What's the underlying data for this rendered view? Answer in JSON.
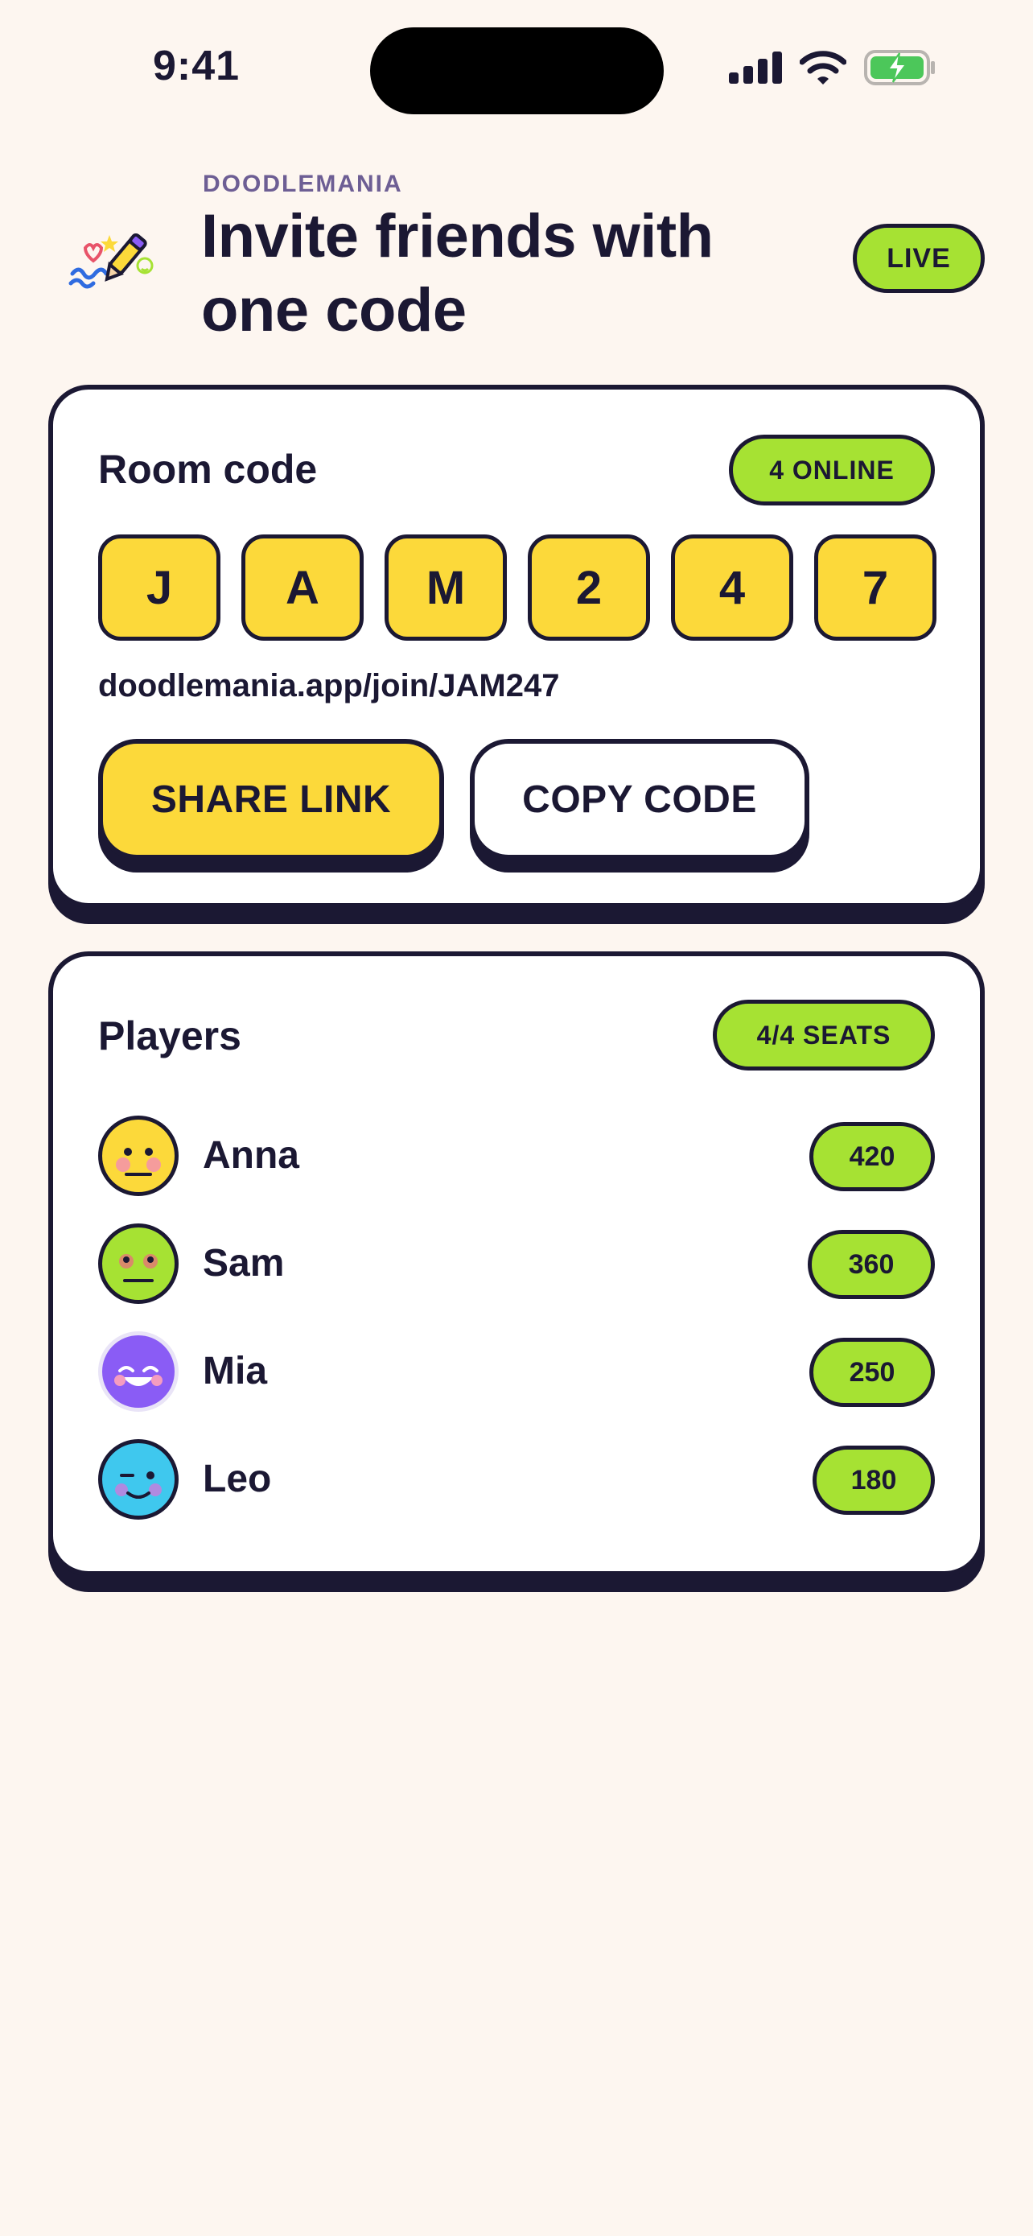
{
  "status_bar": {
    "time": "9:41"
  },
  "header": {
    "brand": "DOODLEMANIA",
    "title": "Invite friends with one code",
    "live_badge": "LIVE",
    "app_icon": "doodle-pencil-icon"
  },
  "room": {
    "heading": "Room code",
    "online_badge": "4 ONLINE",
    "code_chars": [
      "J",
      "A",
      "M",
      "2",
      "4",
      "7"
    ],
    "join_link": "doodlemania.app/join/JAM247",
    "share_label": "SHARE LINK",
    "copy_label": "COPY CODE"
  },
  "players": {
    "heading": "Players",
    "seats_badge": "4/4 SEATS",
    "list": [
      {
        "name": "Anna",
        "score": "420",
        "avatar_color": "#FCD93A",
        "avatar_icon": "smiley-blush-icon"
      },
      {
        "name": "Sam",
        "score": "360",
        "avatar_color": "#A6E233",
        "avatar_icon": "smiley-glasses-icon"
      },
      {
        "name": "Mia",
        "score": "250",
        "avatar_color": "#8A5CF5",
        "avatar_icon": "smiley-grin-icon"
      },
      {
        "name": "Leo",
        "score": "180",
        "avatar_color": "#3FC8EE",
        "avatar_icon": "smiley-wink-icon"
      }
    ]
  },
  "colors": {
    "ink": "#1B1833",
    "accent_yellow": "#FCD93A",
    "accent_green": "#A6E233",
    "background": "#FDF6F0",
    "brand_purple": "#6D5E94"
  }
}
